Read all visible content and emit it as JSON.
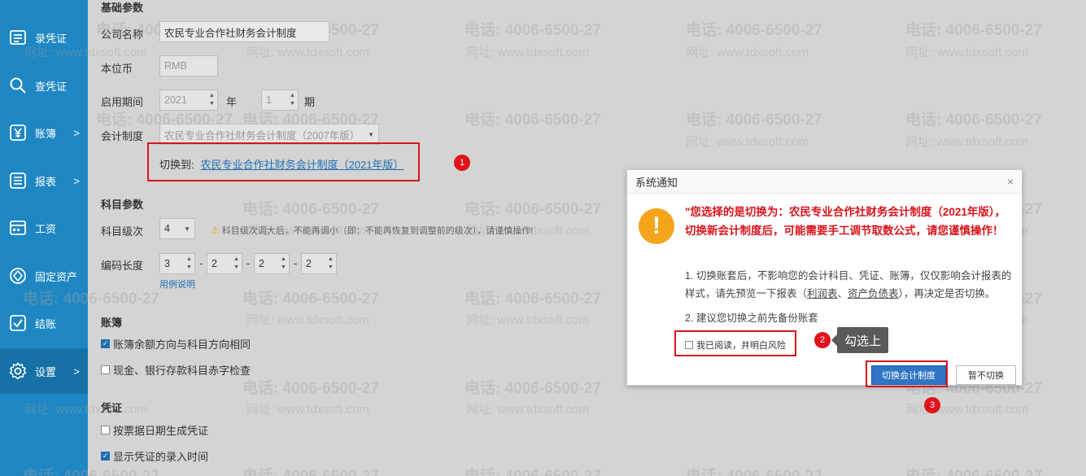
{
  "sidebar": {
    "items": [
      {
        "label": "录凭证",
        "icon": "voucher-entry-icon",
        "arrow": ""
      },
      {
        "label": "查凭证",
        "icon": "search-icon",
        "arrow": ""
      },
      {
        "label": "账簿",
        "icon": "yen-icon",
        "arrow": ">"
      },
      {
        "label": "报表",
        "icon": "report-list-icon",
        "arrow": ">"
      },
      {
        "label": "工资",
        "icon": "salary-icon",
        "arrow": ""
      },
      {
        "label": "固定资产",
        "icon": "asset-icon",
        "arrow": ""
      },
      {
        "label": "结账",
        "icon": "checkout-icon",
        "arrow": ""
      },
      {
        "label": "设置",
        "icon": "gear-icon",
        "arrow": ">"
      }
    ],
    "active_index": 7
  },
  "basic": {
    "section_title": "基础参数",
    "company_label": "公司名称",
    "company_value": "农民专业合作社财务会计制度",
    "currency_label": "本位币",
    "currency_value": "RMB",
    "period_label": "启用期间",
    "year_value": "2021",
    "year_unit": "年",
    "period_value": "1",
    "period_unit": "期",
    "system_label": "会计制度",
    "system_value": "农民专业合作社财务会计制度（2007年版）",
    "switch_prefix": "切换到:",
    "switch_link": "农民专业合作社财务会计制度（2021年版）"
  },
  "subject": {
    "section_title": "科目参数",
    "level_label": "科目级次",
    "level_value": "4",
    "level_warning": "科目级次调大后，不能再调小（即：不能再恢复到调整前的级次），请谨慎操作!",
    "code_label": "编码长度",
    "code_values": [
      "3",
      "2",
      "2",
      "2"
    ],
    "code_sep": "-",
    "help_link": "用例说明"
  },
  "ledger": {
    "section_title": "账簿",
    "options": [
      {
        "label": "账簿余额方向与科目方向相同",
        "checked": true
      },
      {
        "label": "现金、银行存款科目赤字检查",
        "checked": false
      }
    ]
  },
  "voucher": {
    "section_title": "凭证",
    "options": [
      {
        "label": "按票据日期生成凭证",
        "checked": false
      },
      {
        "label": "显示凭证的录入时间",
        "checked": true
      }
    ]
  },
  "watermark": {
    "phone": "电话: 4006-6500-27",
    "site": "网址: www.tdxsoft.com"
  },
  "dialog": {
    "title": "系统通知",
    "close": "×",
    "icon": "!",
    "warning": "\"您选择的是切换为：农民专业合作社财务会计制度（2021年版），切换新会计制度后，可能需要手工调节取数公式，请您谨慎操作！",
    "p1_a": "1. 切换账套后，不影响您的会计科目、凭证、账簿，仅仅影响会计报表的样式，请先预览一下报表（",
    "p1_link1": "利润表",
    "p1_sep": "、",
    "p1_link2": "资产负债表",
    "p1_b": "），再决定是否切换。",
    "p2": "2. 建议您切换之前先备份账套",
    "check_label": "我已阅读，并明白风险",
    "confirm_button": "切换会计制度",
    "cancel_button": "暂不切换"
  },
  "annotations": {
    "badge1": "1",
    "badge2": "2",
    "badge3": "3",
    "tooltip": "勾选上"
  }
}
